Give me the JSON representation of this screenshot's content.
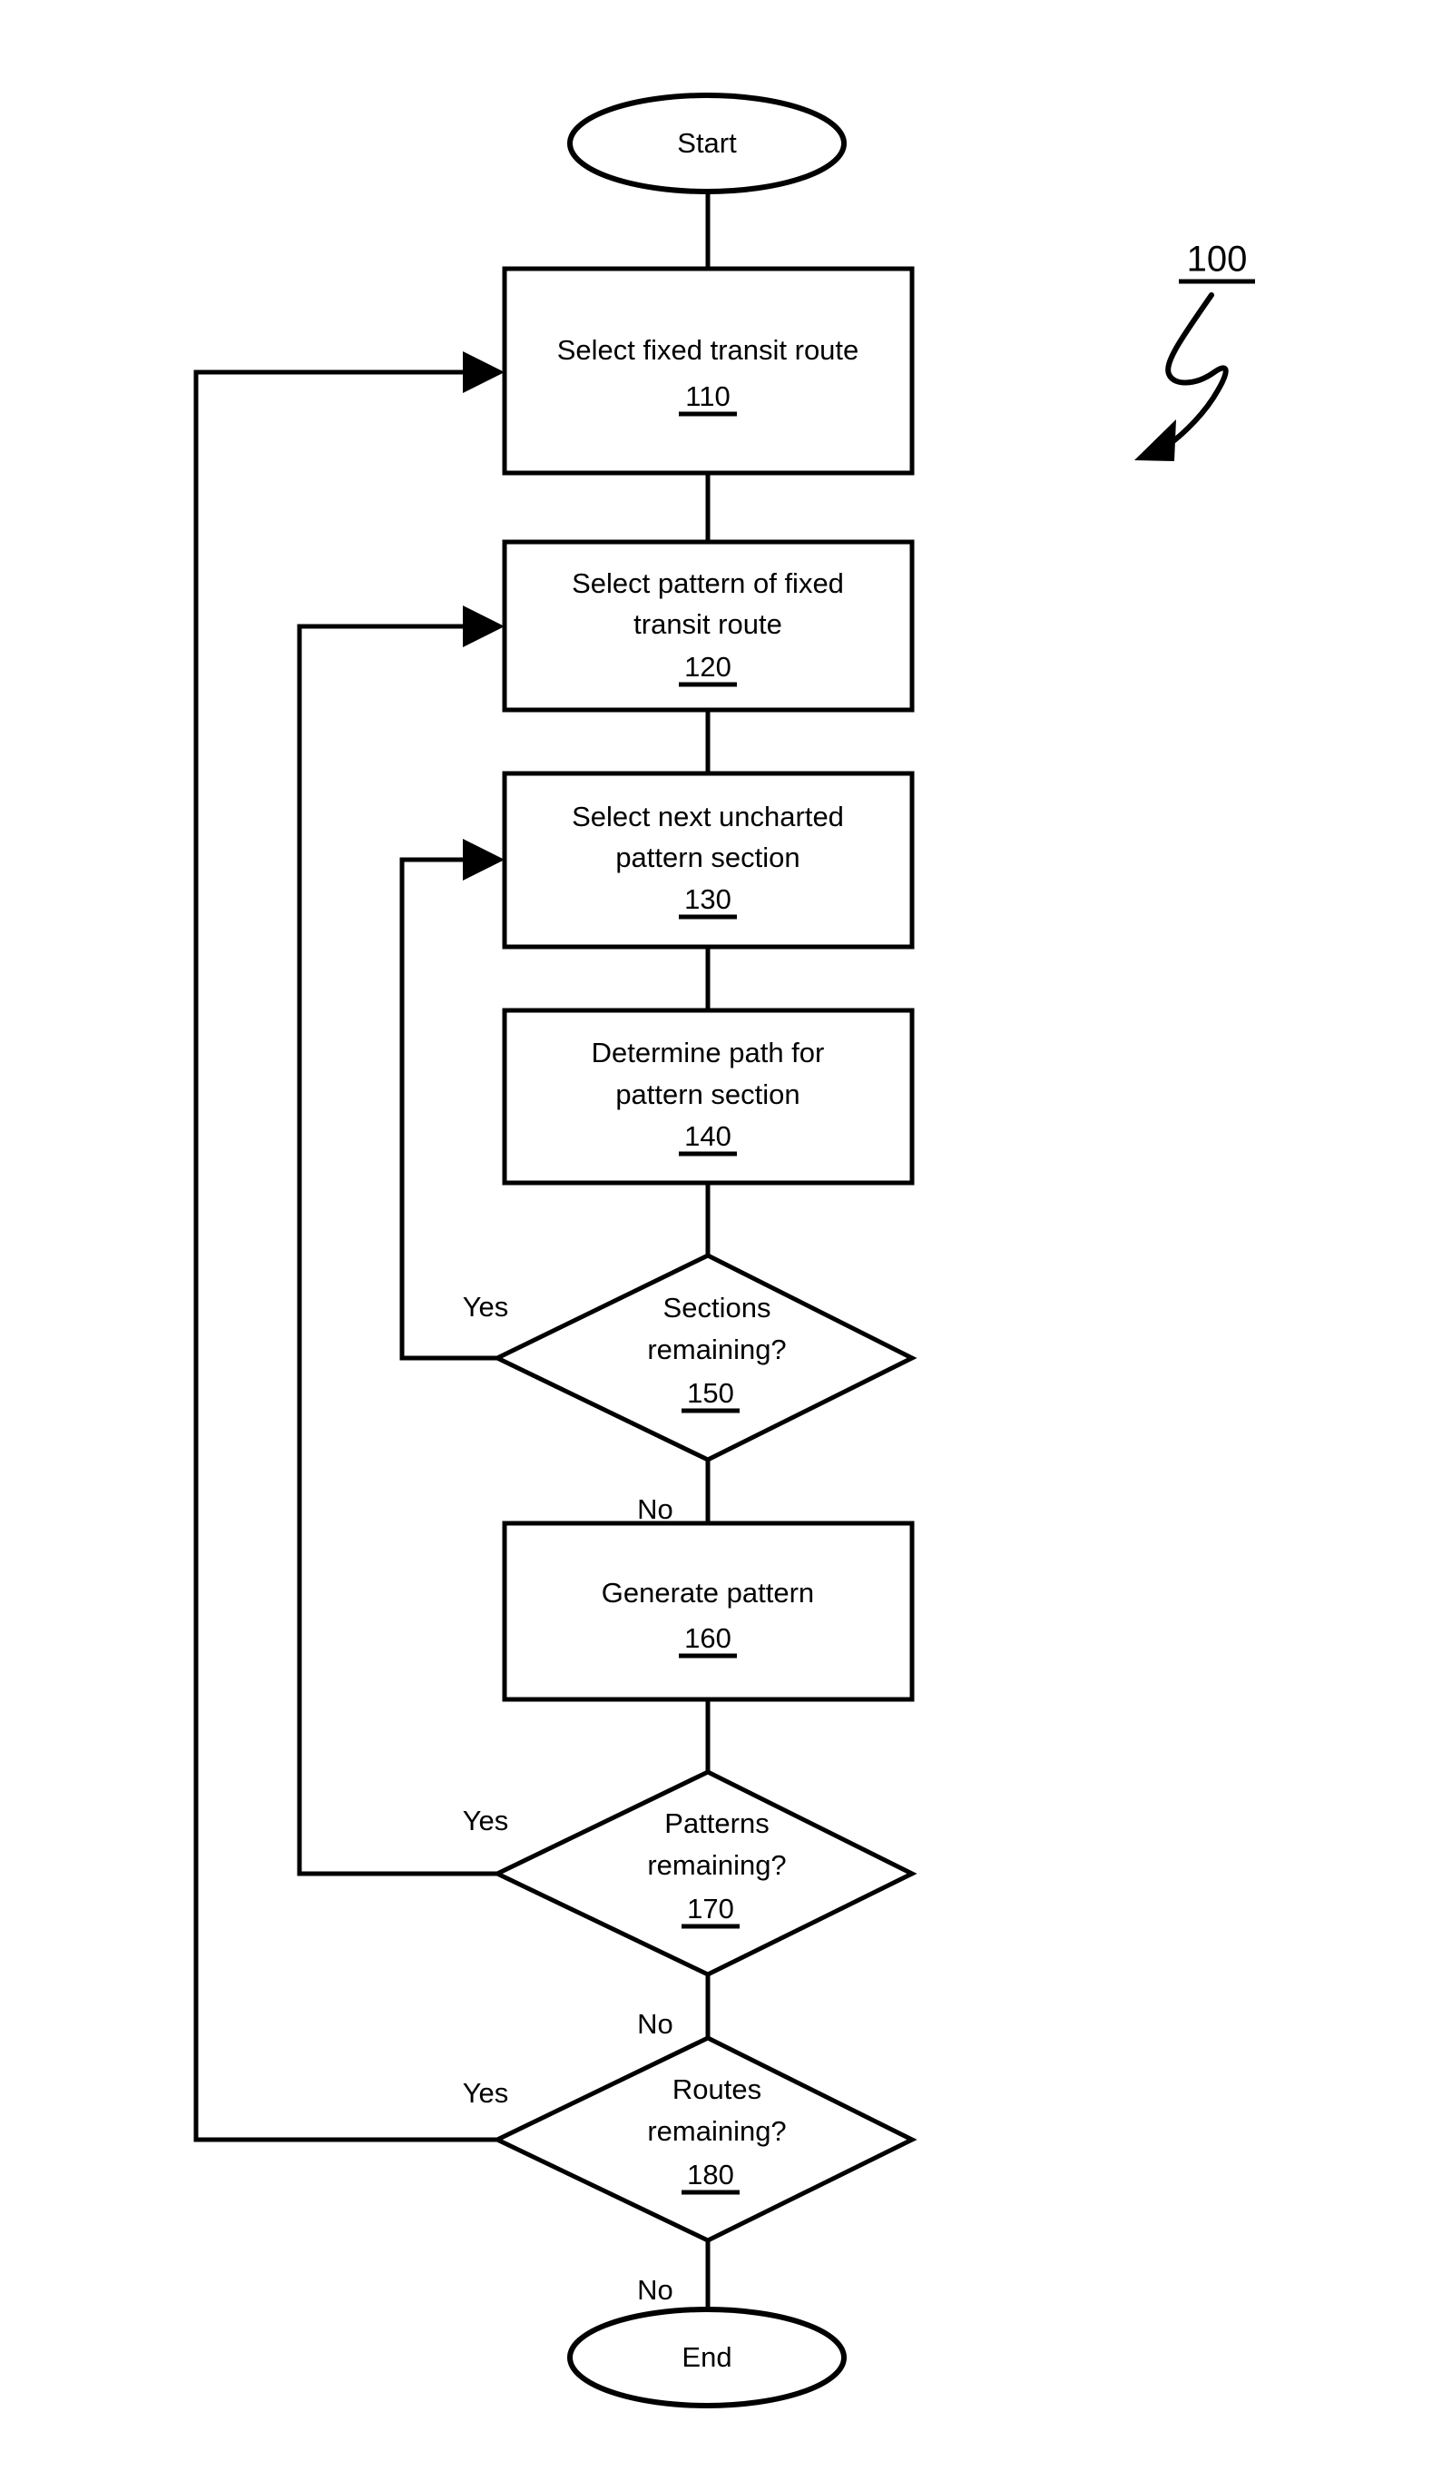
{
  "figure": {
    "number": "100",
    "number_underlined": true
  },
  "nodes": {
    "start": {
      "label": "Start",
      "type": "terminator"
    },
    "end": {
      "label": "End",
      "type": "terminator"
    },
    "step110": {
      "line1": "Select fixed transit route",
      "line2": "",
      "ref": "110",
      "type": "process"
    },
    "step120": {
      "line1": "Select pattern of fixed",
      "line2": "transit route",
      "ref": "120",
      "type": "process"
    },
    "step130": {
      "line1": "Select next uncharted",
      "line2": "pattern section",
      "ref": "130",
      "type": "process"
    },
    "step140": {
      "line1": "Determine path for",
      "line2": "pattern section",
      "ref": "140",
      "type": "process"
    },
    "step150": {
      "line1": "Sections",
      "line2": "remaining?",
      "ref": "150",
      "type": "decision"
    },
    "step160": {
      "line1": "Generate pattern",
      "line2": "",
      "ref": "160",
      "type": "process"
    },
    "step170": {
      "line1": "Patterns",
      "line2": "remaining?",
      "ref": "170",
      "type": "decision"
    },
    "step180": {
      "line1": "Routes",
      "line2": "remaining?",
      "ref": "180",
      "type": "decision"
    }
  },
  "branch_labels": {
    "yes_150": "Yes",
    "no_150": "No",
    "yes_170": "Yes",
    "no_170": "No",
    "yes_180": "Yes",
    "no_180": "No"
  },
  "colors": {
    "stroke": "#000000",
    "fill": "#ffffff",
    "background": "#ffffff"
  }
}
